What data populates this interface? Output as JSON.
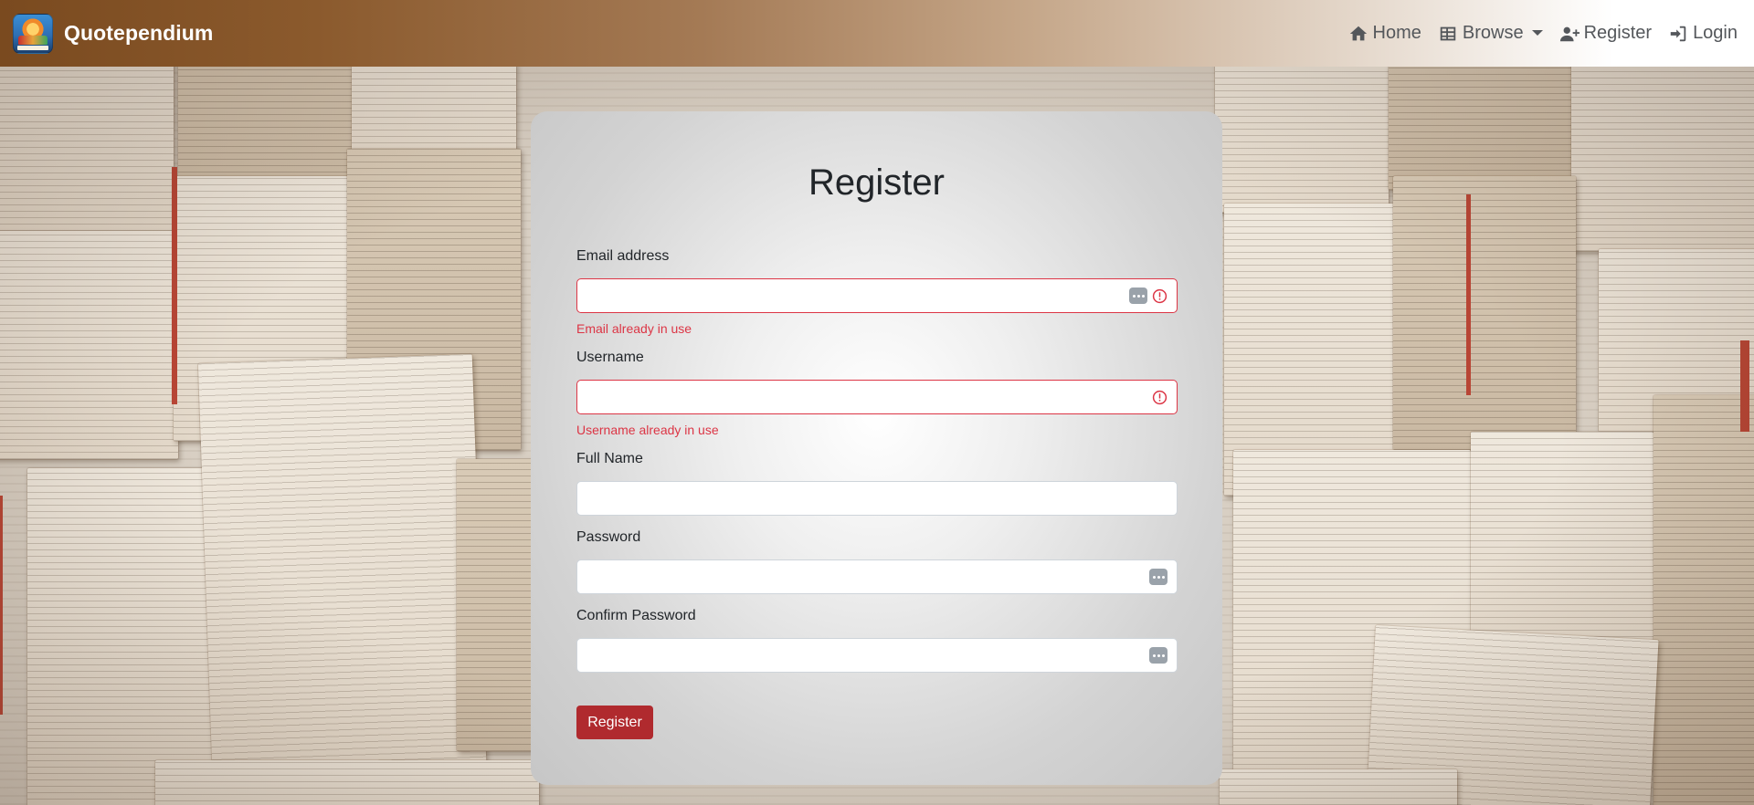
{
  "brand": {
    "name": "Quotependium",
    "logo_icon": "app-logo-icon"
  },
  "nav": {
    "home": "Home",
    "browse": "Browse",
    "register": "Register",
    "login": "Login"
  },
  "form": {
    "title": "Register",
    "email": {
      "label": "Email address",
      "value": "",
      "error": "Email already in use"
    },
    "username": {
      "label": "Username",
      "value": "",
      "error": "Username already in use"
    },
    "full_name": {
      "label": "Full Name",
      "value": ""
    },
    "password": {
      "label": "Password",
      "value": ""
    },
    "confirm_password": {
      "label": "Confirm Password",
      "value": ""
    },
    "submit_label": "Register"
  },
  "colors": {
    "error": "#dc3545",
    "button": "#b02a2e",
    "nav_text": "#54575b",
    "brand_text": "#ffffff"
  }
}
